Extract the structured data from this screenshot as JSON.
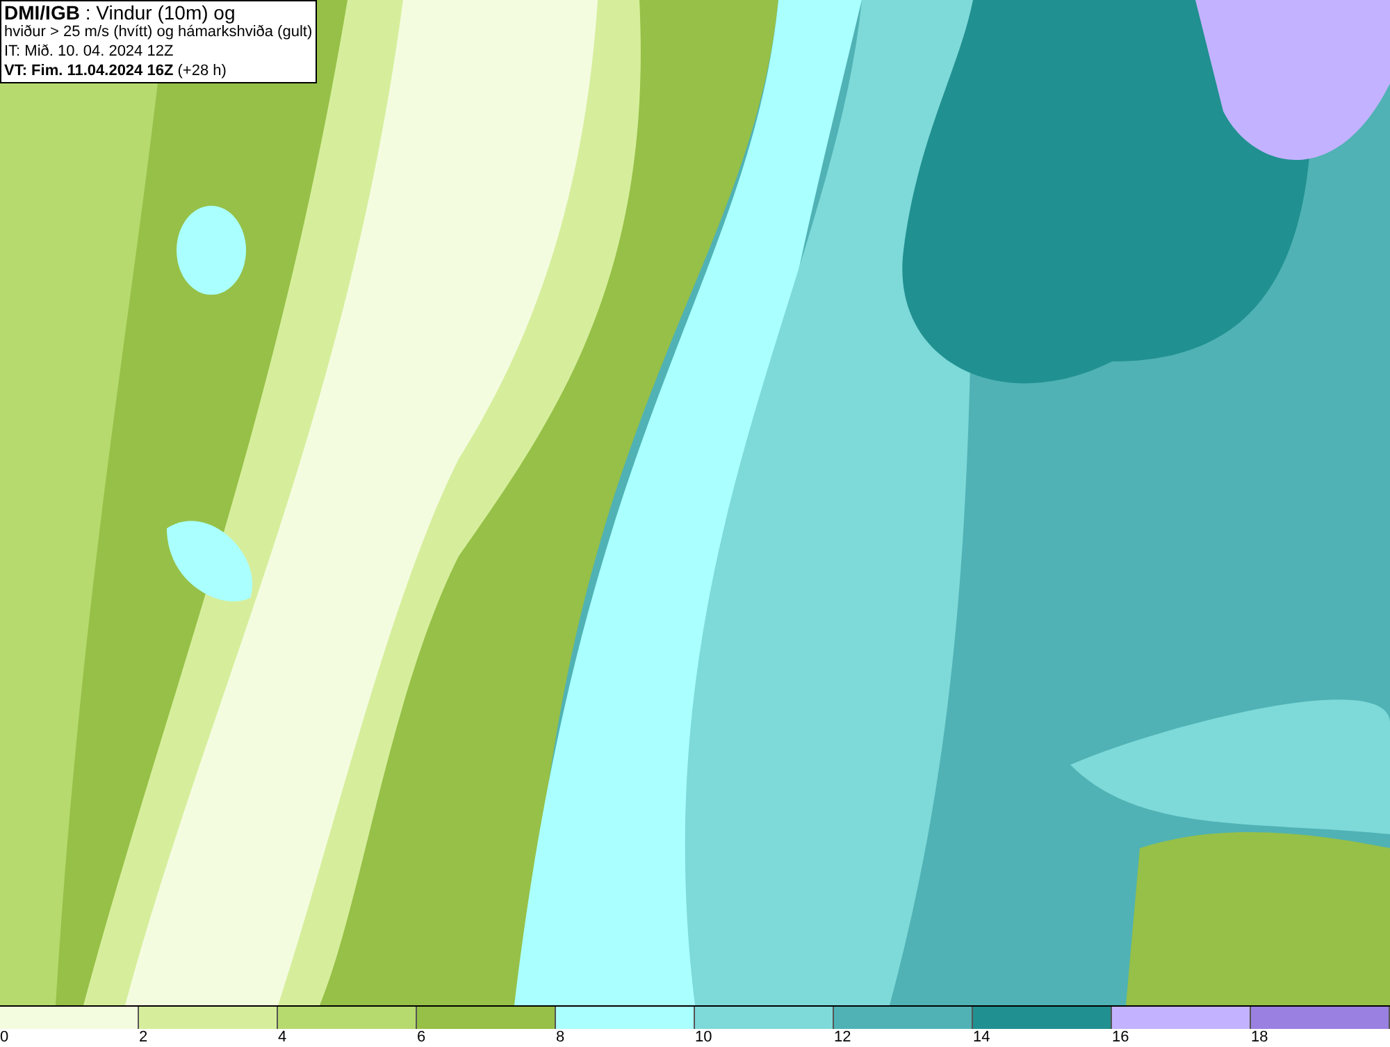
{
  "header": {
    "lines": [
      "**DMI/IGB** : Vindur (10m) og",
      "hviður > 25 m/s (hvítt) og hámarkshviða (gult)",
      "IT: Mið. 10. 04. 2024 12Z",
      "**VT: Fim. 11.04.2024 16Z** (+28 h)"
    ]
  },
  "legend": {
    "bins": [
      {
        "label": "0",
        "color": "#f4fce0"
      },
      {
        "label": "2",
        "color": "#d6ee9c"
      },
      {
        "label": "4",
        "color": "#b6da6e"
      },
      {
        "label": "6",
        "color": "#96c047"
      },
      {
        "label": "8",
        "color": "#aaffff"
      },
      {
        "label": "10",
        "color": "#7ed9d9"
      },
      {
        "label": "12",
        "color": "#50b2b4"
      },
      {
        "label": "14",
        "color": "#219090"
      },
      {
        "label": "16",
        "color": "#c3b2ff"
      },
      {
        "label": "18",
        "color": "#9a80e0"
      }
    ]
  }
}
